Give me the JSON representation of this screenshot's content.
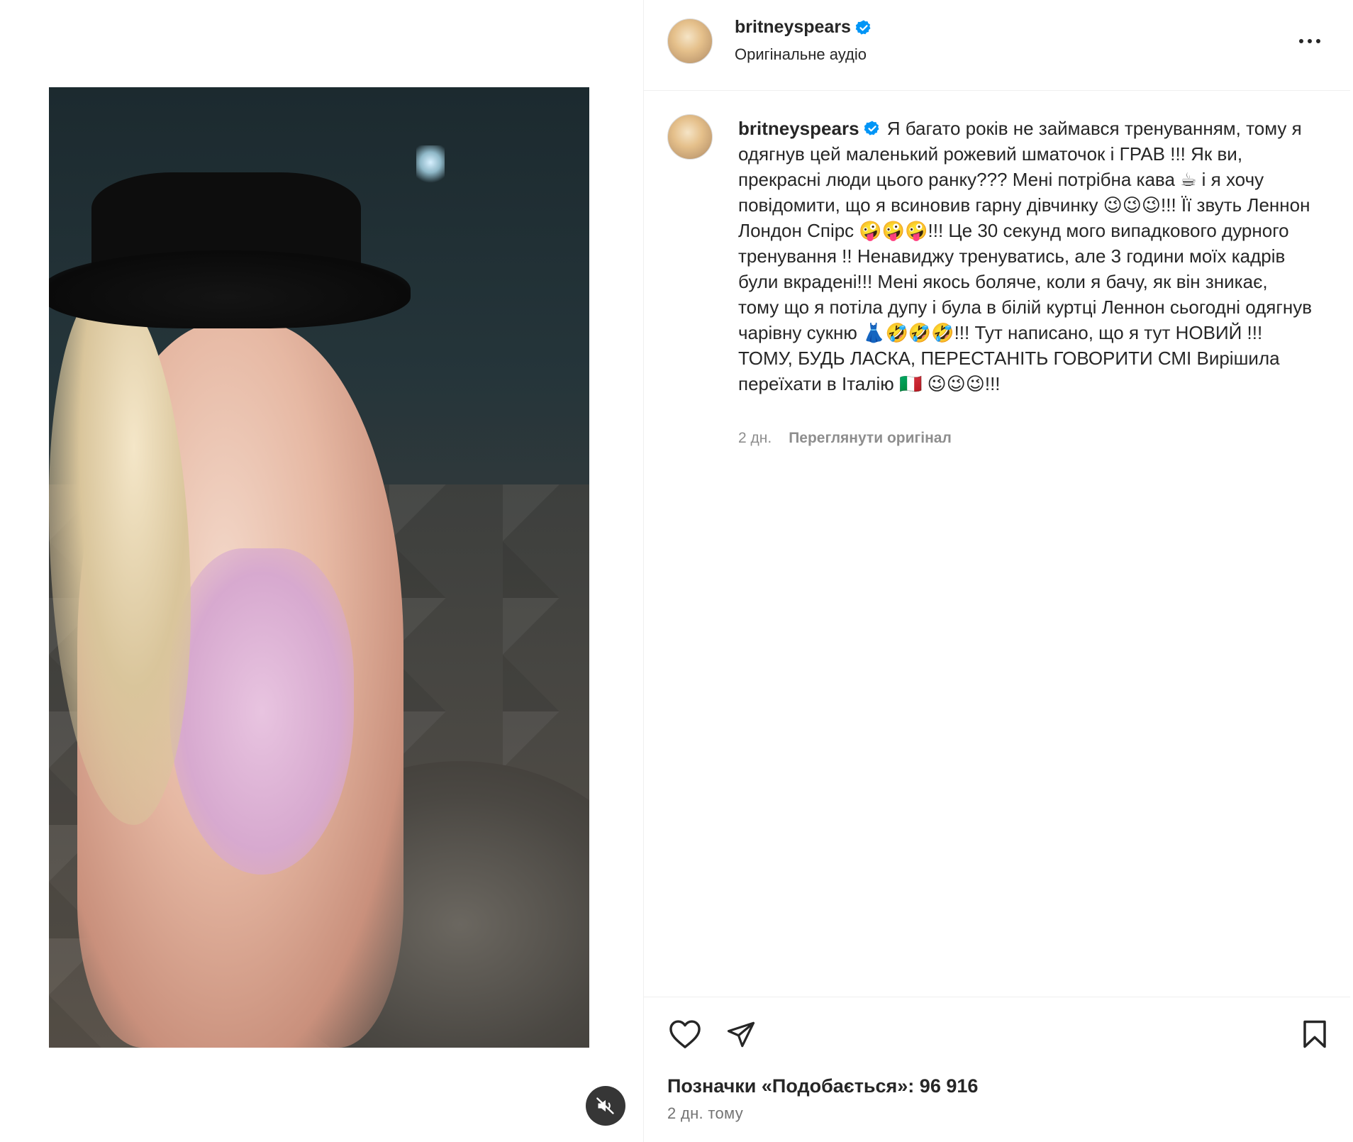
{
  "header": {
    "username": "britneyspears",
    "subtitle": "Оригінальне аудіо",
    "verified": true,
    "verified_color": "#0095f6"
  },
  "caption": {
    "username": "britneyspears",
    "text": "Я багато років не займався тренуванням, тому я одягнув цей маленький рожевий шматочок і ГРАВ !!! Як ви, прекрасні люди цього ранку??? Мені потрібна кава ☕ і я хочу повідомити, що я всиновив гарну дівчинку 😉😉😉!!! Її звуть Леннон Лондон Спірс 🤪🤪🤪!!! Це 30 секунд мого випадкового дурного тренування !! Ненавиджу тренуватись, але 3 години моїх кадрів були вкрадені!!! Мені якось боляче, коли я бачу, як він зникає, тому що я потіла дупу і була в білій куртці Леннон сьогодні одягнув чарівну сукню 👗🤣🤣🤣!!! Тут написано, що я тут НОВИЙ !!! ТОМУ, БУДЬ ЛАСКА, ПЕРЕСТАНІТЬ ГОВОРИТИ СМІ Вирішила переїхати в Італію 🇮🇹 😉😉😉!!!",
    "age": "2 дн.",
    "translate_label": "Переглянути оригінал"
  },
  "likes": {
    "label": "Позначки «Подобається»: 96 916"
  },
  "timestamp": "2 дн. тому",
  "icons": {
    "more": "more-horizontal-icon",
    "like": "heart-outline-icon",
    "share": "paper-plane-icon",
    "save": "bookmark-outline-icon",
    "mute": "speaker-muted-icon"
  }
}
